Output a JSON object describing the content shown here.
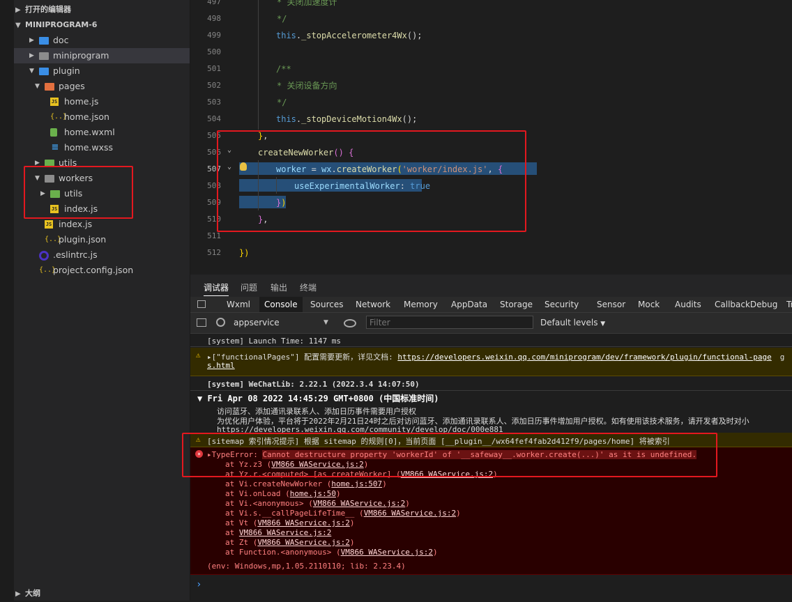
{
  "explorer": {
    "open_editors": "打开的编辑器",
    "project": "MINIPROGRAM-6",
    "outline": "大纲",
    "tree": [
      {
        "label": "doc",
        "depth": 1,
        "kind": "folder",
        "icon": "folder-doc-icon",
        "twisty": "▶"
      },
      {
        "label": "miniprogram",
        "depth": 1,
        "kind": "folder",
        "icon": "folder-icon",
        "twisty": "▶",
        "selected": true
      },
      {
        "label": "plugin",
        "depth": 1,
        "kind": "folder",
        "icon": "folder-plugin-icon",
        "twisty": "▼"
      },
      {
        "label": "pages",
        "depth": 2,
        "kind": "folder",
        "icon": "folder-pages-icon",
        "twisty": "▼"
      },
      {
        "label": "home.js",
        "depth": 3,
        "kind": "js",
        "icon": "js-file-icon"
      },
      {
        "label": "home.json",
        "depth": 3,
        "kind": "json",
        "icon": "json-file-icon"
      },
      {
        "label": "home.wxml",
        "depth": 3,
        "kind": "wxml",
        "icon": "wxml-file-icon"
      },
      {
        "label": "home.wxss",
        "depth": 3,
        "kind": "wxss",
        "icon": "wxss-file-icon"
      },
      {
        "label": "utils",
        "depth": 2,
        "kind": "folder",
        "icon": "folder-utils-icon",
        "twisty": "▶"
      },
      {
        "label": "workers",
        "depth": 2,
        "kind": "folder",
        "icon": "folder-open-icon",
        "twisty": "▼"
      },
      {
        "label": "utils",
        "depth": 3,
        "kind": "folder",
        "icon": "folder-utils-icon",
        "twisty": "▶"
      },
      {
        "label": "index.js",
        "depth": 3,
        "kind": "js",
        "icon": "js-file-icon"
      },
      {
        "label": "index.js",
        "depth": 2,
        "kind": "js",
        "icon": "js-file-icon"
      },
      {
        "label": "plugin.json",
        "depth": 2,
        "kind": "json",
        "icon": "json-file-icon"
      },
      {
        "label": ".eslintrc.js",
        "depth": 1,
        "kind": "eslint",
        "icon": "eslint-file-icon"
      },
      {
        "label": "project.config.json",
        "depth": 1,
        "kind": "json",
        "icon": "json-file-icon"
      }
    ]
  },
  "editor": {
    "lines": [
      {
        "n": "497",
        "tokens": [
          [
            "cm",
            "* 关闭加速度计"
          ]
        ]
      },
      {
        "n": "498",
        "tokens": [
          [
            "cm",
            "*/"
          ]
        ]
      },
      {
        "n": "499",
        "tokens": [
          [
            "kw",
            "this"
          ],
          [
            "pu",
            "."
          ],
          [
            "fn",
            "_stopAccelerometer4Wx"
          ],
          [
            "pu",
            "();"
          ]
        ]
      },
      {
        "n": "500",
        "tokens": []
      },
      {
        "n": "501",
        "tokens": [
          [
            "cm",
            "/**"
          ]
        ]
      },
      {
        "n": "502",
        "tokens": [
          [
            "cm",
            "* 关闭设备方向"
          ]
        ]
      },
      {
        "n": "503",
        "tokens": [
          [
            "cm",
            "*/"
          ]
        ]
      },
      {
        "n": "504",
        "tokens": [
          [
            "kw",
            "this"
          ],
          [
            "pu",
            "."
          ],
          [
            "fn",
            "_stopDeviceMotion4Wx"
          ],
          [
            "pu",
            "();"
          ]
        ]
      },
      {
        "n": "505",
        "tokens": [
          [
            "br2",
            "}"
          ],
          [
            "pu",
            ","
          ]
        ]
      },
      {
        "n": "506",
        "tokens": [
          [
            "fn",
            "createNewWorker"
          ],
          [
            "br",
            "()"
          ],
          [
            "pu",
            " "
          ],
          [
            "br",
            "{"
          ]
        ]
      },
      {
        "n": "507",
        "tokens": [
          [
            "pr",
            "worker"
          ],
          [
            "pu",
            " = "
          ],
          [
            "pr",
            "wx"
          ],
          [
            "pu",
            "."
          ],
          [
            "fn",
            "createWorker"
          ],
          [
            "br2",
            "("
          ],
          [
            "str",
            "'worker/index.js'"
          ],
          [
            "pu",
            ", "
          ],
          [
            "br",
            "{"
          ]
        ]
      },
      {
        "n": "508",
        "tokens": [
          [
            "pr",
            "useExperimentalWorker"
          ],
          [
            "pu",
            ": "
          ],
          [
            "kw",
            "true"
          ]
        ]
      },
      {
        "n": "509",
        "tokens": [
          [
            "br",
            "}"
          ],
          [
            "br2",
            ")"
          ]
        ]
      },
      {
        "n": "510",
        "tokens": [
          [
            "br",
            "}"
          ],
          [
            "pu",
            ","
          ]
        ]
      },
      {
        "n": "511",
        "tokens": []
      },
      {
        "n": "512",
        "tokens": [
          [
            "br2",
            "})"
          ]
        ]
      }
    ]
  },
  "panel": {
    "top_tabs": [
      "调试器",
      "问题",
      "输出",
      "终端"
    ],
    "dev_tabs": [
      "Wxml",
      "Console",
      "Sources",
      "Network",
      "Memory",
      "AppData",
      "Storage",
      "Security",
      "Sensor",
      "Mock",
      "Audits",
      "CallbackDebug",
      "Tr"
    ],
    "context": "appservice",
    "filter_placeholder": "Filter",
    "levels": "Default levels",
    "prompt": "›"
  },
  "console": {
    "launch_time": "[system] Launch Time: 1147 ms",
    "functional_pages": {
      "prefix": "▸[\"functionalPages\"] 配置需要更新，详见文档: ",
      "link": "https://developers.weixin.qq.com/miniprogram/dev/framework/plugin/functional-page",
      "link_cont": "s.html",
      "tail": "g"
    },
    "wechatlib": "[system] WeChatLib: 2.22.1 (2022.3.4 14:07:50)",
    "date_group": "▼ Fri Apr 08 2022 14:45:29 GMT+0800 (中国标准时间)",
    "auth_1": "访问蓝牙、添加通讯录联系人、添加日历事件需要用户授权",
    "auth_2": "为优化用户体验，平台将于2022年2月21日24时之后对访问蓝牙、添加通讯录联系人、添加日历事件增加用户授权。如有使用该技术服务，请开发者及时对小",
    "auth_3": "https://developers.weixin.qq.com/community/develop/doc/000e881",
    "sitemap": "[sitemap 索引情况提示] 根据 sitemap 的规则[0]，当前页面 [__plugin__/wx64fef4fab2d412f9/pages/home] 将被索引",
    "error_head": "▸TypeError: ",
    "error_msg": "Cannot destructure property 'workerId' of '__safeway__.worker.create(...)' as it is undefined.",
    "stack": [
      {
        "pre": "at Yz.z3 (",
        "link": "VM866 WAService.js:2",
        "post": ")"
      },
      {
        "pre": "at Yz.r.<computed> [as createWorker] (",
        "link": "VM866 WAService.js:2",
        "post": ")"
      },
      {
        "pre": "at Vi.createNewWorker (",
        "link": "home.js:507",
        "post": ")"
      },
      {
        "pre": "at Vi.onLoad (",
        "link": "home.js:50",
        "post": ")"
      },
      {
        "pre": "at Vi.<anonymous> (",
        "link": "VM866 WAService.js:2",
        "post": ")"
      },
      {
        "pre": "at Vi.s.__callPageLifeTime__ (",
        "link": "VM866 WAService.js:2",
        "post": ")"
      },
      {
        "pre": "at Vt (",
        "link": "VM866 WAService.js:2",
        "post": ")"
      },
      {
        "pre": "at ",
        "link": "VM866 WAService.js:2",
        "post": ""
      },
      {
        "pre": "at Zt (",
        "link": "VM866 WAService.js:2",
        "post": ")"
      },
      {
        "pre": "at Function.<anonymous> (",
        "link": "VM866 WAService.js:2",
        "post": ")"
      }
    ],
    "env": "(env: Windows,mp,1.05.2110110; lib: 2.23.4)"
  }
}
